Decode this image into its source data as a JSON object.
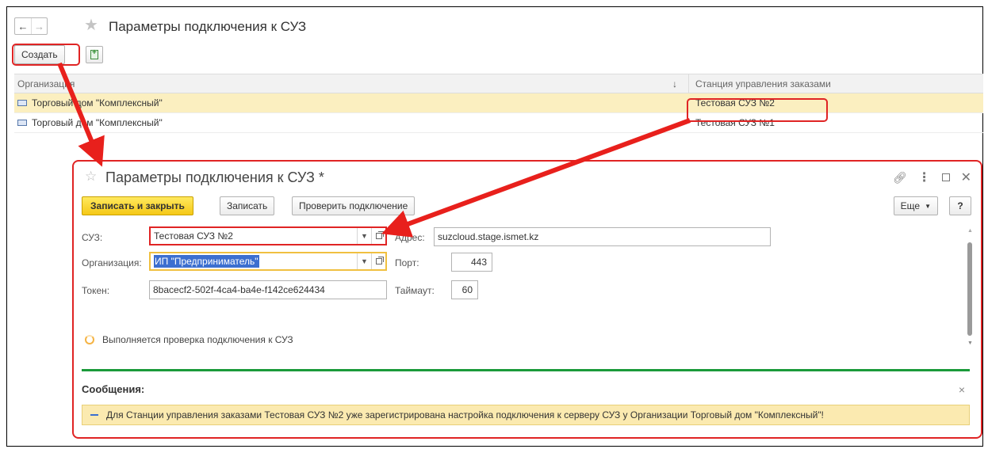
{
  "window": {
    "title": "Параметры подключения к СУЗ",
    "back_glyph": "←",
    "forward_glyph": "→"
  },
  "toolbar": {
    "create_label": "Создать"
  },
  "list": {
    "columns": {
      "organization": "Организация",
      "station": "Станция управления заказами"
    },
    "sort_glyph": "↓",
    "rows": [
      {
        "organization": "Торговый дом \"Комплексный\"",
        "station": "Тестовая СУЗ №2",
        "selected": true
      },
      {
        "organization": "Торговый дом \"Комплексный\"",
        "station": "Тестовая СУЗ №1",
        "selected": false
      }
    ]
  },
  "dialog": {
    "title": "Параметры подключения к СУЗ *",
    "buttons": {
      "save_close": "Записать и закрыть",
      "save": "Записать",
      "check": "Проверить подключение",
      "more": "Еще",
      "help": "?"
    },
    "fields": {
      "suz_label": "СУЗ:",
      "suz_value": "Тестовая СУЗ №2",
      "org_label": "Организация:",
      "org_value": "ИП \"Предприниматель\"",
      "token_label": "Токен:",
      "token_value": "8bacecf2-502f-4ca4-ba4e-f142ce624434",
      "address_label": "Адрес:",
      "address_value": "suzcloud.stage.ismet.kz",
      "port_label": "Порт:",
      "port_value": "443",
      "timeout_label": "Таймаут:",
      "timeout_value": "60"
    },
    "status_text": "Выполняется проверка подключения к СУЗ",
    "messages": {
      "title": "Сообщения:",
      "items": [
        "Для Станции управления заказами Тестовая СУЗ №2 уже зарегистрирована настройка подключения к серверу СУЗ у Организации Торговый дом \"Комплексный\"!"
      ]
    }
  },
  "colors": {
    "highlight": "#e02424",
    "selected_row": "#fbefc0",
    "primary_button": "#f5c816",
    "message_bg": "#fbeab0",
    "separator": "#1a9a3a"
  }
}
